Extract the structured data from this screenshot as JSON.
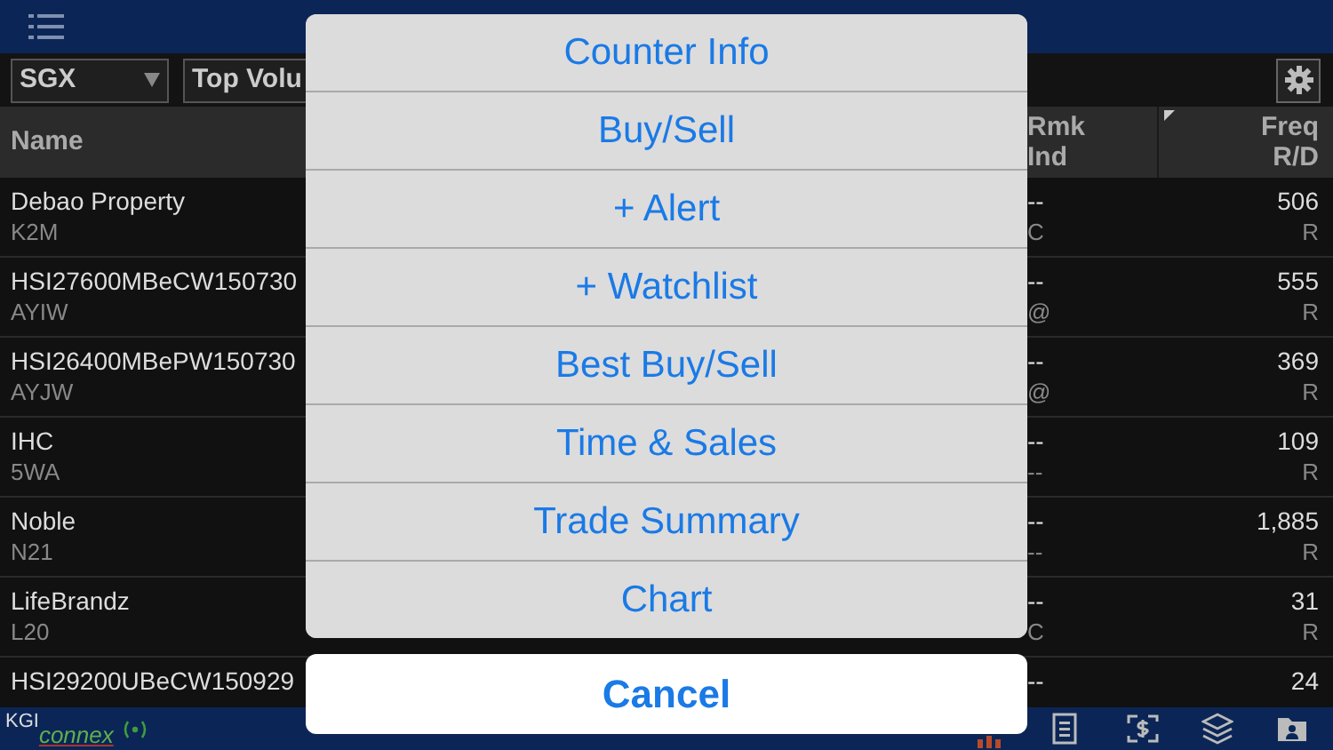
{
  "filters": {
    "exchange": "SGX",
    "list": "Top Volu"
  },
  "table": {
    "columns": [
      {
        "label": "Name"
      },
      {
        "label": "Rmk",
        "label2": "Ind"
      },
      {
        "label": "Freq",
        "label2": "R/D"
      }
    ],
    "rows": [
      {
        "name": "Debao Property",
        "code": "K2M",
        "rmk": "--",
        "ind": "C",
        "freq": "506",
        "rd": "R"
      },
      {
        "name": "HSI27600MBeCW150730",
        "code": "AYIW",
        "rmk": "--",
        "ind": "@",
        "freq": "555",
        "rd": "R"
      },
      {
        "name": "HSI26400MBePW150730",
        "code": "AYJW",
        "rmk": "--",
        "ind": "@",
        "freq": "369",
        "rd": "R"
      },
      {
        "name": "IHC",
        "code": "5WA",
        "rmk": "--",
        "ind": "--",
        "freq": "109",
        "rd": "R"
      },
      {
        "name": "Noble",
        "code": "N21",
        "rmk": "--",
        "ind": "--",
        "freq": "1,885",
        "rd": "R"
      },
      {
        "name": "LifeBrandz",
        "code": "L20",
        "rmk": "--",
        "ind": "C",
        "freq": "31",
        "rd": "R"
      },
      {
        "name": "HSI29200UBeCW150929",
        "rmk": "--",
        "freq": "24"
      }
    ]
  },
  "action_sheet": {
    "items": [
      "Counter Info",
      "Buy/Sell",
      "+ Alert",
      "+ Watchlist",
      "Best Buy/Sell",
      "Time & Sales",
      "Trade Summary",
      "Chart"
    ],
    "cancel": "Cancel"
  },
  "footer": {
    "brand": "KGI",
    "brand2": "connex"
  }
}
